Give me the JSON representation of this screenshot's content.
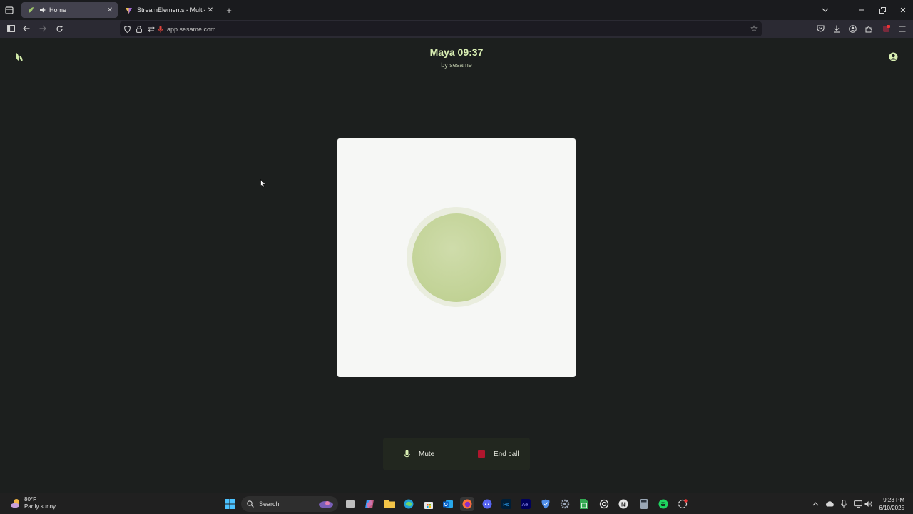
{
  "browser": {
    "tabs": [
      {
        "label": "Home",
        "active": true
      },
      {
        "label": "StreamElements - Multi-Stream",
        "active": false
      }
    ],
    "url": "app.sesame.com"
  },
  "page": {
    "title": "Maya 09:37",
    "subtitle": "by sesame",
    "controls": {
      "mute_label": "Mute",
      "end_call_label": "End call"
    }
  },
  "taskbar": {
    "weather": {
      "temp": "80°F",
      "condition": "Partly sunny"
    },
    "search_label": "Search",
    "time": "9:23 PM",
    "date": "6/10/2025"
  },
  "colors": {
    "page_bg": "#1c1f1e",
    "accent_title": "#d9efb3",
    "orb": "#c1d295",
    "end_call": "#b0162d"
  },
  "icons": {
    "tab_audio": "speaker-icon",
    "mute": "microphone-icon",
    "end_call": "stop-square-icon",
    "account": "user-circle-icon"
  }
}
